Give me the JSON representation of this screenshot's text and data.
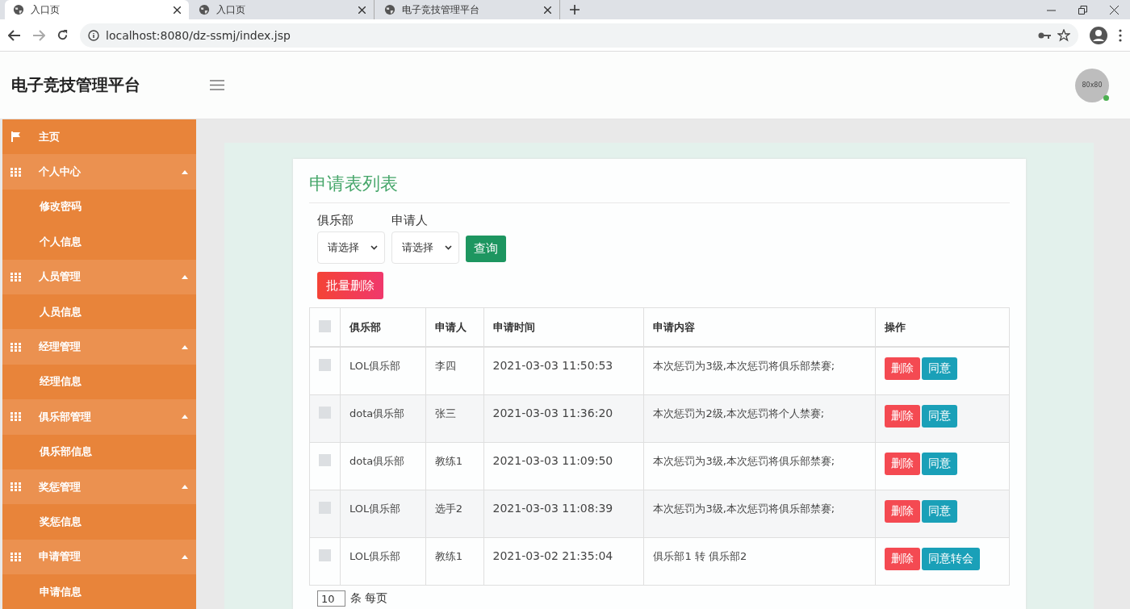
{
  "browser": {
    "tabs": [
      {
        "title": "入口页",
        "selected": true
      },
      {
        "title": "入口页",
        "selected": false
      },
      {
        "title": "电子竞技管理平台",
        "selected": false
      }
    ],
    "url": "localhost:8080/dz-ssmj/index.jsp"
  },
  "header": {
    "brand": "电子竞技管理平台",
    "avatar_text": "80x80"
  },
  "sidebar": {
    "items": [
      {
        "kind": "link",
        "label": "主页"
      },
      {
        "kind": "group",
        "label": "个人中心",
        "expanded": true,
        "children": [
          {
            "label": "修改密码"
          },
          {
            "label": "个人信息"
          }
        ]
      },
      {
        "kind": "group",
        "label": "人员管理",
        "expanded": true,
        "children": [
          {
            "label": "人员信息"
          }
        ]
      },
      {
        "kind": "group",
        "label": "经理管理",
        "expanded": true,
        "children": [
          {
            "label": "经理信息"
          }
        ]
      },
      {
        "kind": "group",
        "label": "俱乐部管理",
        "expanded": true,
        "children": [
          {
            "label": "俱乐部信息"
          }
        ]
      },
      {
        "kind": "group",
        "label": "奖惩管理",
        "expanded": true,
        "children": [
          {
            "label": "奖惩信息"
          }
        ]
      },
      {
        "kind": "group",
        "label": "申请管理",
        "expanded": true,
        "children": [
          {
            "label": "申请信息"
          }
        ]
      }
    ]
  },
  "panel": {
    "title": "申请表列表",
    "filters": [
      {
        "label": "俱乐部",
        "value": "请选择"
      },
      {
        "label": "申请人",
        "value": "请选择"
      }
    ],
    "query_button": "查询",
    "batch_delete_button": "批量删除",
    "table": {
      "columns": [
        "俱乐部",
        "申请人",
        "申请时间",
        "申请内容",
        "操作"
      ],
      "select_all_checked": false,
      "rows": [
        {
          "checked": false,
          "club": "LOL俱乐部",
          "applicant": "李四",
          "time": "2021-03-03 11:50:53",
          "content": "本次惩罚为3级,本次惩罚将俱乐部禁赛;",
          "actions": [
            "删除",
            "同意"
          ]
        },
        {
          "checked": false,
          "club": "dota俱乐部",
          "applicant": "张三",
          "time": "2021-03-03 11:36:20",
          "content": "本次惩罚为2级,本次惩罚将个人禁赛;",
          "actions": [
            "删除",
            "同意"
          ]
        },
        {
          "checked": false,
          "club": "dota俱乐部",
          "applicant": "教练1",
          "time": "2021-03-03 11:09:50",
          "content": "本次惩罚为3级,本次惩罚将俱乐部禁赛;",
          "actions": [
            "删除",
            "同意"
          ]
        },
        {
          "checked": false,
          "club": "LOL俱乐部",
          "applicant": "选手2",
          "time": "2021-03-03 11:08:39",
          "content": "本次惩罚为3级,本次惩罚将俱乐部禁赛;",
          "actions": [
            "删除",
            "同意"
          ]
        },
        {
          "checked": false,
          "club": "LOL俱乐部",
          "applicant": "教练1",
          "time": "2021-03-02 21:35:04",
          "content": "俱乐部1 转 俱乐部2",
          "actions": [
            "删除",
            "同意转会"
          ]
        }
      ]
    },
    "pagination": {
      "page_size": "10",
      "label": "条 每页"
    }
  }
}
